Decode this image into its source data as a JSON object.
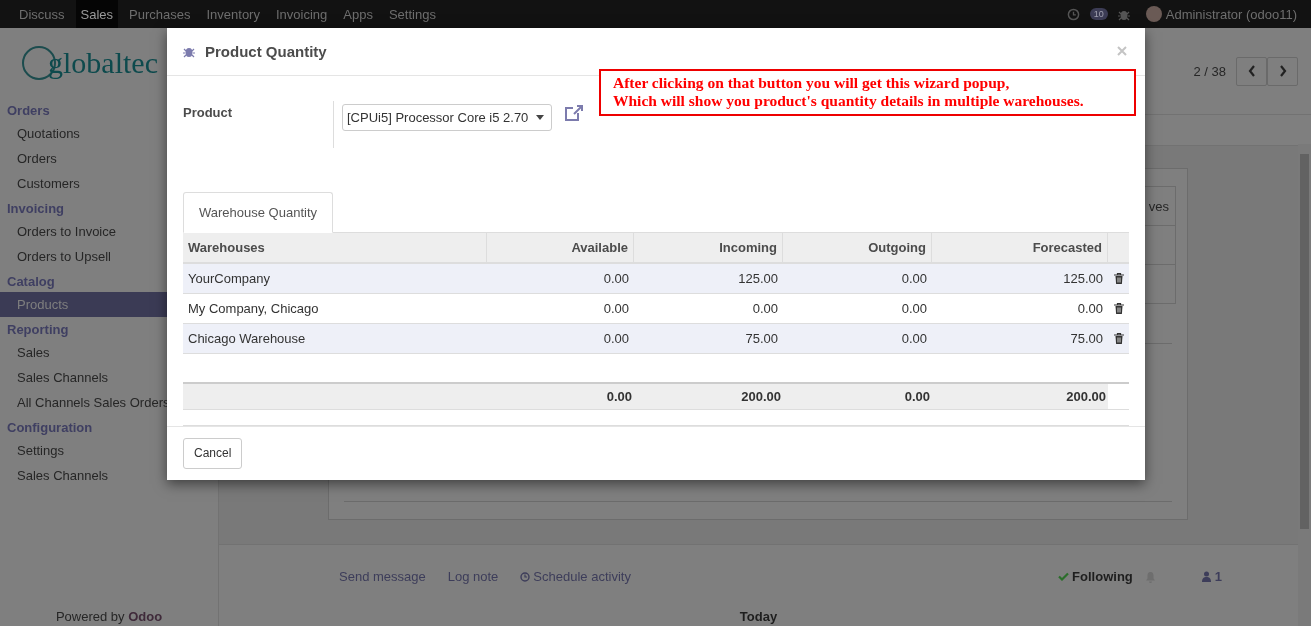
{
  "navbar": {
    "menu": [
      {
        "label": "Discuss",
        "selected": false
      },
      {
        "label": "Sales",
        "selected": true
      },
      {
        "label": "Purchases",
        "selected": false
      },
      {
        "label": "Inventory",
        "selected": false
      },
      {
        "label": "Invoicing",
        "selected": false
      },
      {
        "label": "Apps",
        "selected": false
      },
      {
        "label": "Settings",
        "selected": false
      }
    ],
    "messages_badge": "10",
    "user": "Administrator (odoo11)"
  },
  "sidebar": {
    "logo": "globaltec",
    "sections": [
      {
        "title": "Orders",
        "items": [
          {
            "label": "Quotations",
            "selected": false
          },
          {
            "label": "Orders",
            "selected": false
          },
          {
            "label": "Customers",
            "selected": false
          }
        ]
      },
      {
        "title": "Invoicing",
        "items": [
          {
            "label": "Orders to Invoice",
            "selected": false
          },
          {
            "label": "Orders to Upsell",
            "selected": false
          }
        ]
      },
      {
        "title": "Catalog",
        "items": [
          {
            "label": "Products",
            "selected": true
          }
        ]
      },
      {
        "title": "Reporting",
        "items": [
          {
            "label": "Sales",
            "selected": false
          },
          {
            "label": "Sales Channels",
            "selected": false
          },
          {
            "label": "All Channels Sales Orders",
            "selected": false
          }
        ]
      },
      {
        "title": "Configuration",
        "items": [
          {
            "label": "Settings",
            "selected": false
          },
          {
            "label": "Sales Channels",
            "selected": false
          }
        ]
      }
    ],
    "footer_prefix": "Powered by",
    "footer_brand": "Odoo"
  },
  "pager": {
    "value": "2 / 38"
  },
  "background_form": {
    "column_1": "ves"
  },
  "chatter": {
    "links": [
      "Send message",
      "Log note",
      "Schedule activity"
    ],
    "following": "Following",
    "followers": "1",
    "today": "Today"
  },
  "dialog": {
    "title": "Product Quantity",
    "field_label": "Product",
    "product": "[CPUi5] Processor Core i5 2.70",
    "tabs": [
      {
        "label": "Warehouse Quantity",
        "selected": true
      }
    ],
    "columns": [
      "Warehouses",
      "Available",
      "Incoming",
      "Outgoing",
      "Forecasted"
    ],
    "rows": [
      {
        "cells": [
          "YourCompany",
          "0.00",
          "125.00",
          "0.00",
          "125.00"
        ]
      },
      {
        "cells": [
          "My Company, Chicago",
          "0.00",
          "0.00",
          "0.00",
          "0.00"
        ]
      },
      {
        "cells": [
          "Chicago Warehouse",
          "0.00",
          "75.00",
          "0.00",
          "75.00"
        ]
      }
    ],
    "totals": [
      "0.00",
      "200.00",
      "0.00",
      "200.00"
    ],
    "buttons": [
      "Cancel"
    ]
  },
  "annotation": {
    "lines": [
      "After clicking on that button you will get this wizard popup,",
      "Which will show you product's quantity details in multiple warehouses."
    ]
  }
}
